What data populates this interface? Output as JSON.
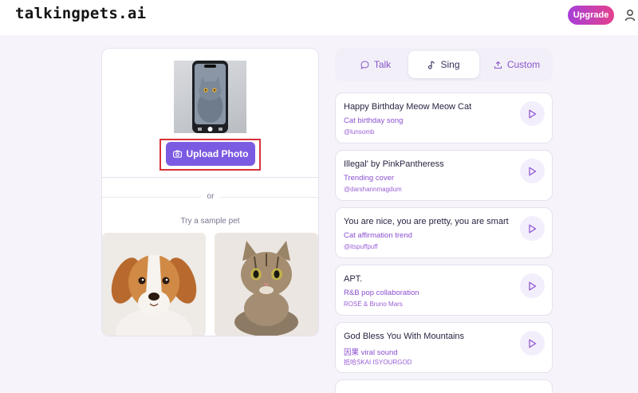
{
  "header": {
    "logo": "talkingpets.ai",
    "upgrade_label": "Upgrade"
  },
  "upload": {
    "button_label": "Upload Photo",
    "or_label": "or",
    "sample_label": "Try a sample pet"
  },
  "tabs": [
    {
      "label": "Talk",
      "icon": "speech-bubble-icon"
    },
    {
      "label": "Sing",
      "icon": "music-note-icon",
      "active": true
    },
    {
      "label": "Custom",
      "icon": "upload-icon"
    }
  ],
  "songs": [
    {
      "title": "Happy Birthday Meow Meow Cat",
      "subtitle": "Cat birthday song",
      "author": "@lunsomb"
    },
    {
      "title": "Illegal' by PinkPantheress",
      "subtitle": "Trending cover",
      "author": "@darshannmagdum"
    },
    {
      "title": "You are nice, you are pretty, you are smart",
      "subtitle": "Cat affirmation trend",
      "author": "@itspuffpuff"
    },
    {
      "title": "APT.",
      "subtitle": "R&B pop collaboration",
      "author": "ROSÉ & Bruno Mars"
    },
    {
      "title": "God Bless You With Mountains",
      "subtitle": "因果 viral sound",
      "author": "抵哈SKAI ISYOURGOD"
    }
  ],
  "colors": {
    "accent": "#7c5be3",
    "upgrade_gradient_start": "#a63fd8",
    "upgrade_gradient_end": "#e5408c",
    "highlight": "#d8313a"
  }
}
